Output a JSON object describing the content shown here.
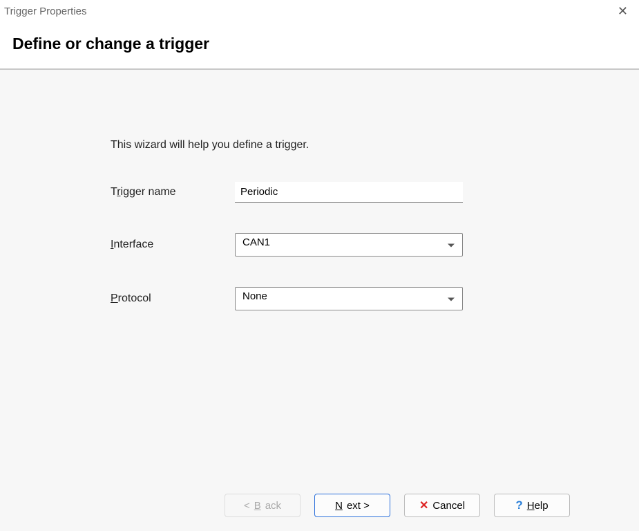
{
  "window": {
    "title": "Trigger Properties"
  },
  "header": {
    "title": "Define or change a trigger"
  },
  "content": {
    "intro": "This wizard will help you define a trigger.",
    "trigger_name": {
      "label_pre": "T",
      "label_accel": "r",
      "label_post": "igger name",
      "value": "Periodic"
    },
    "interface": {
      "label_pre": "",
      "label_accel": "I",
      "label_post": "nterface",
      "value": "CAN1"
    },
    "protocol": {
      "label_pre": "",
      "label_accel": "P",
      "label_post": "rotocol",
      "value": "None"
    }
  },
  "buttons": {
    "back": {
      "pre": "< ",
      "accel": "B",
      "post": "ack"
    },
    "next": {
      "accel": "N",
      "post": "ext >"
    },
    "cancel": {
      "label": "Cancel"
    },
    "help": {
      "accel": "H",
      "post": "elp"
    }
  }
}
